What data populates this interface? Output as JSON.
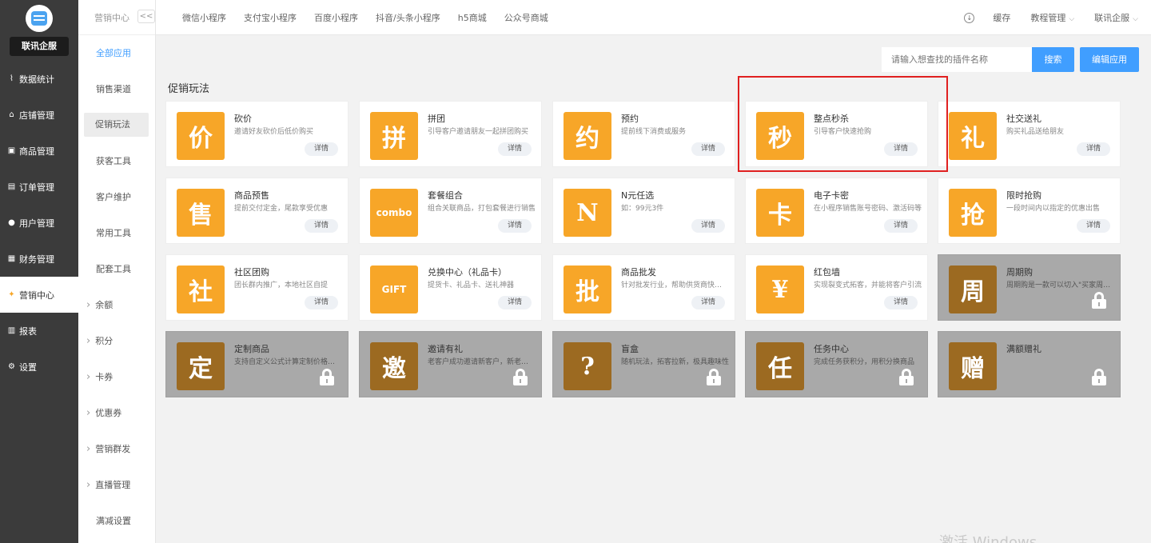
{
  "sidebar": {
    "brand": "联讯企服",
    "items": [
      {
        "label": "数据统计",
        "icon": "chart-icon"
      },
      {
        "label": "店铺管理",
        "icon": "store-icon"
      },
      {
        "label": "商品管理",
        "icon": "goods-icon"
      },
      {
        "label": "订单管理",
        "icon": "order-icon"
      },
      {
        "label": "用户管理",
        "icon": "user-icon"
      },
      {
        "label": "财务管理",
        "icon": "finance-icon"
      },
      {
        "label": "营销中心",
        "icon": "marketing-icon"
      },
      {
        "label": "报表",
        "icon": "report-icon"
      },
      {
        "label": "设置",
        "icon": "settings-icon"
      }
    ]
  },
  "subnav": {
    "title": "营销中心",
    "collapse": "<<",
    "items": [
      "全部应用",
      "销售渠道",
      "促销玩法",
      "获客工具",
      "客户维护",
      "常用工具",
      "配套工具",
      "余额",
      "积分",
      "卡券",
      "优惠券",
      "营销群发",
      "直播管理",
      "满减设置"
    ]
  },
  "topbar": {
    "tabs": [
      "微信小程序",
      "支付宝小程序",
      "百度小程序",
      "抖音/头条小程序",
      "h5商城",
      "公众号商城"
    ],
    "cache": "缓存",
    "tutorial": "教程管理",
    "account": "联讯企服"
  },
  "toolbar": {
    "search_placeholder": "请输入想查找的插件名称",
    "search_button": "搜索",
    "edit_button": "编辑应用"
  },
  "section_title": "促销玩法",
  "detail_label": "详情",
  "cards": [
    {
      "name": "砍价",
      "desc": "邀请好友砍价后低价购买",
      "glyph": "价",
      "locked": false
    },
    {
      "name": "拼团",
      "desc": "引导客户邀请朋友一起拼团购买",
      "glyph": "拼",
      "locked": false
    },
    {
      "name": "预约",
      "desc": "提前线下消费或服务",
      "glyph": "约",
      "locked": false
    },
    {
      "name": "整点秒杀",
      "desc": "引导客户快速抢购",
      "glyph": "秒",
      "locked": false
    },
    {
      "name": "社交送礼",
      "desc": "购买礼品送给朋友",
      "glyph": "礼",
      "locked": false
    },
    {
      "name": "商品预售",
      "desc": "提前交付定金，尾款享受优惠",
      "glyph": "售",
      "locked": false
    },
    {
      "name": "套餐组合",
      "desc": "组合关联商品，打包套餐进行销售",
      "glyph": "combo",
      "locked": false
    },
    {
      "name": "N元任选",
      "desc": "如：99元3件",
      "glyph": "N",
      "locked": false
    },
    {
      "name": "电子卡密",
      "desc": "在小程序销售账号密码、激活码等",
      "glyph": "卡",
      "locked": false
    },
    {
      "name": "限时抢购",
      "desc": "一段时间内以指定的优惠出售",
      "glyph": "抢",
      "locked": false
    },
    {
      "name": "社区团购",
      "desc": "团长群内推广，本地社区自提",
      "glyph": "社",
      "locked": false
    },
    {
      "name": "兑换中心（礼品卡）",
      "desc": "提货卡、礼品卡、送礼神器",
      "glyph": "GIFT",
      "locked": false
    },
    {
      "name": "商品批发",
      "desc": "针对批发行业，帮助供货商快速批发",
      "glyph": "批",
      "locked": false
    },
    {
      "name": "红包墙",
      "desc": "实现裂变式拓客，并能将客户引流",
      "glyph": "¥",
      "locked": false
    },
    {
      "name": "周期购",
      "desc": "周期购是一款可以切入\"买家周期性消费\"",
      "glyph": "周",
      "locked": true
    },
    {
      "name": "定制商品",
      "desc": "支持自定义公式计算定制价格的商品",
      "glyph": "定",
      "locked": true
    },
    {
      "name": "邀请有礼",
      "desc": "老客户成功邀请新客户，新老客户均可获得奖励",
      "glyph": "邀",
      "locked": true
    },
    {
      "name": "盲盒",
      "desc": "随机玩法，拓客拉新，极具趣味性",
      "glyph": "?",
      "locked": true
    },
    {
      "name": "任务中心",
      "desc": "完成任务获积分，用积分换商品",
      "glyph": "任",
      "locked": true
    },
    {
      "name": "满额赠礼",
      "desc": "",
      "glyph": "赠",
      "locked": true
    }
  ],
  "watermark": "激活 Windows",
  "colors": {
    "accent": "#409eff",
    "icon_orange": "#f7a628",
    "locked_bg": "#a9a9a9",
    "highlight": "#e02020",
    "sidebar": "#3b3b3b"
  }
}
